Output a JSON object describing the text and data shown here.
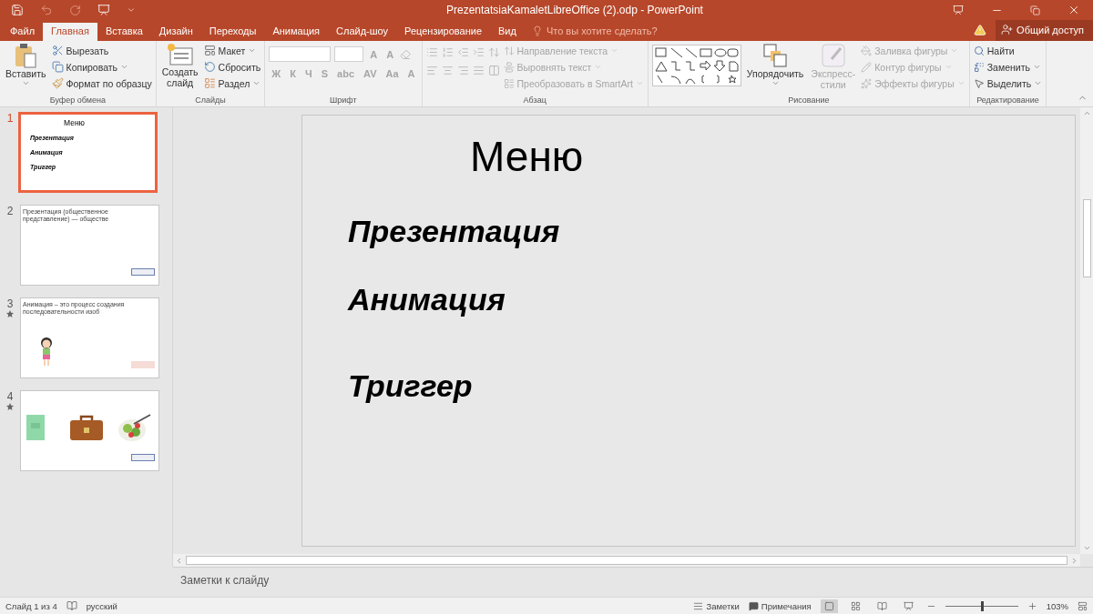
{
  "window": {
    "title": "PrezentatsiaKamaletLibreOffice (2).odp - PowerPoint"
  },
  "tabs": [
    {
      "label": "Файл",
      "selected": false
    },
    {
      "label": "Главная",
      "selected": true
    },
    {
      "label": "Вставка",
      "selected": false
    },
    {
      "label": "Дизайн",
      "selected": false
    },
    {
      "label": "Переходы",
      "selected": false
    },
    {
      "label": "Анимация",
      "selected": false
    },
    {
      "label": "Слайд-шоу",
      "selected": false
    },
    {
      "label": "Рецензирование",
      "selected": false
    },
    {
      "label": "Вид",
      "selected": false
    }
  ],
  "tell_me": {
    "placeholder": "Что вы хотите сделать?"
  },
  "share": {
    "label": "Общий доступ"
  },
  "ribbon": {
    "clipboard": {
      "label": "Буфер обмена",
      "paste": "Вставить",
      "cut": "Вырезать",
      "copy": "Копировать",
      "format_painter": "Формат по образцу"
    },
    "slides": {
      "label": "Слайды",
      "new_slide": [
        "Создать",
        "слайд"
      ],
      "layout": "Макет",
      "reset": "Сбросить",
      "section": "Раздел"
    },
    "font": {
      "label": "Шрифт",
      "disabled": true,
      "size_buttons": [
        "A",
        "A"
      ],
      "style_buttons": [
        "Ж",
        "К",
        "Ч",
        "S",
        "abc",
        "AV",
        "Aa",
        "A"
      ]
    },
    "paragraph": {
      "label": "Абзац",
      "disabled": true,
      "commands": [
        "Направление текста",
        "Выровнять текст",
        "Преобразовать в SmartArt"
      ]
    },
    "drawing": {
      "label": "Рисование",
      "arrange": "Упорядочить",
      "quick_styles": [
        "Экспресс-",
        "стили"
      ],
      "commands": [
        "Заливка фигуры",
        "Контур фигуры",
        "Эффекты фигуры"
      ],
      "disabled": true
    },
    "editing": {
      "label": "Редактирование",
      "commands": [
        "Найти",
        "Заменить",
        "Выделить"
      ]
    }
  },
  "slides": [
    {
      "number": "1",
      "selected": true,
      "animated": false,
      "kind": "menu",
      "title": "Меню",
      "items": [
        "Презентация",
        "Анимация",
        "Триггер"
      ]
    },
    {
      "number": "2",
      "selected": false,
      "animated": false,
      "kind": "text",
      "text": "Презентация (общественное представление) — обществе"
    },
    {
      "number": "3",
      "selected": false,
      "animated": true,
      "kind": "figure",
      "text": "Анимация – это процесс создания последовательности изоб"
    },
    {
      "number": "4",
      "selected": false,
      "animated": true,
      "kind": "pictures"
    }
  ],
  "current_slide": {
    "title": "Меню",
    "items": [
      "Презентация",
      "Анимация",
      "Триггер"
    ]
  },
  "notes": {
    "placeholder": "Заметки к слайду"
  },
  "status_bar": {
    "slide": "Слайд 1 из 4",
    "language": "русский",
    "notes": "Заметки",
    "comments": "Примечания",
    "zoom": {
      "level": 0.5,
      "reading": "103%"
    }
  }
}
